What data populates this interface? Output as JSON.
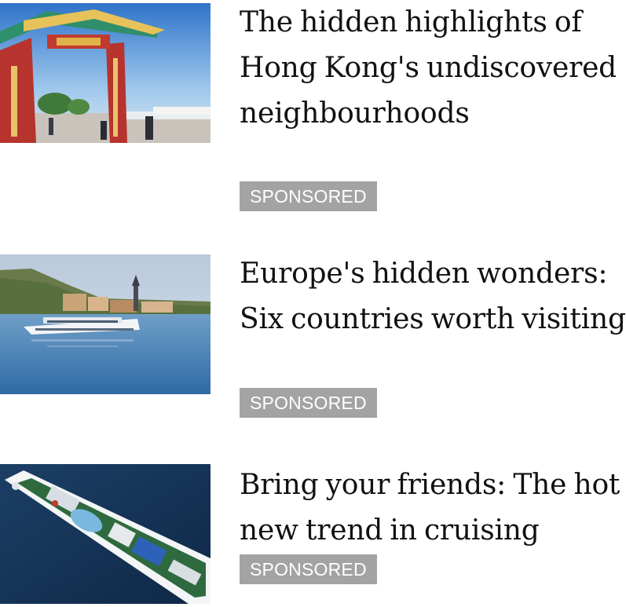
{
  "articles": [
    {
      "thumbnail": "hong-kong-gate-photo",
      "headline": "The hidden highlights of Hong Kong's undiscovered neighbourhoods",
      "badge": "SPONSORED"
    },
    {
      "thumbnail": "river-cruise-europe-photo",
      "headline": "Europe's hidden wonders: Six countries worth visiting",
      "badge": "SPONSORED"
    },
    {
      "thumbnail": "cruise-ship-aerial-photo",
      "headline": "Bring your friends: The hot new trend in cruising",
      "badge": "SPONSORED"
    }
  ],
  "colors": {
    "badge_background": "#a3a3a3",
    "badge_text": "#ffffff",
    "headline_text": "#111111"
  }
}
